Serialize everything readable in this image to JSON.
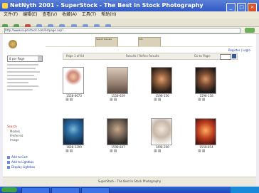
{
  "window": {
    "title": "NetNyth 2001 - SuperStock - The Best In Stock Photography"
  },
  "menu": [
    "文件(F)",
    "编辑(E)",
    "查看(V)",
    "收藏(A)",
    "工具(T)",
    "帮助(H)"
  ],
  "address": {
    "value": "http://www.superstock.com/listpage.asp?..."
  },
  "header": {
    "banner1": "Search Results",
    "banner2": "Info",
    "toplink": "Register | Login"
  },
  "sidebar": {
    "select_value": "8 per Page",
    "menu_label": "Search",
    "sub1": "Models",
    "sub2": "Preferred",
    "sub3": "Image",
    "action1": "Add to Cart",
    "action2": "Add to Lightbox",
    "action3": "Display Lightbox"
  },
  "content": {
    "page_label": "Page 1 of 64",
    "results_label": "Results / Refine Results",
    "sort_label": "Go to Page:",
    "thumbs": [
      {
        "id": "1558-6673"
      },
      {
        "id": "1558-659"
      },
      {
        "id": "1598-156"
      },
      {
        "id": "1598-158"
      },
      {
        "id": "1688-1299"
      },
      {
        "id": "1598-847"
      },
      {
        "id": "1498-266"
      },
      {
        "id": "1558-854"
      }
    ]
  },
  "footer": {
    "text": "SuperStock - The Best In Stock Photography"
  },
  "colors": {
    "accent": "#3159c4",
    "link": "#1a3fa0",
    "alert": "#c0302a"
  }
}
